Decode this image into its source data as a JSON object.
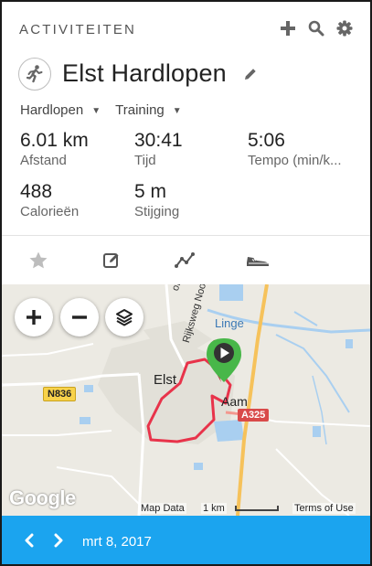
{
  "header": {
    "title": "ACTIVITEITEN",
    "icons": [
      "plus-icon",
      "search-icon",
      "gear-icon"
    ]
  },
  "activity": {
    "icon": "running-person-icon",
    "title": "Elst Hardlopen",
    "type_label": "Hardlopen",
    "event_label": "Training"
  },
  "stats": [
    {
      "value": "6.01 km",
      "label": "Afstand"
    },
    {
      "value": "30:41",
      "label": "Tijd"
    },
    {
      "value": "5:06",
      "label": "Tempo (min/k..."
    },
    {
      "value": "488",
      "label": "Calorieën"
    },
    {
      "value": "5 m",
      "label": "Stijging"
    }
  ],
  "toolbar": {
    "icons": [
      "star-icon",
      "edit-note-icon",
      "chart-line-icon",
      "shoe-icon"
    ]
  },
  "map": {
    "town_label": "Elst",
    "village_label": "Aam",
    "river_label": "Linge",
    "road_label": "Rijksweg Noo",
    "road_label_2": "of",
    "sign_n836": "N836",
    "sign_a325": "A325",
    "google_logo": "Google",
    "map_data": "Map Data",
    "scale": "1 km",
    "terms": "Terms of Use"
  },
  "footer": {
    "date": "mrt 8, 2017"
  },
  "colors": {
    "accent": "#1ba4ef",
    "route": "#e8334a",
    "marker": "#48b749"
  }
}
